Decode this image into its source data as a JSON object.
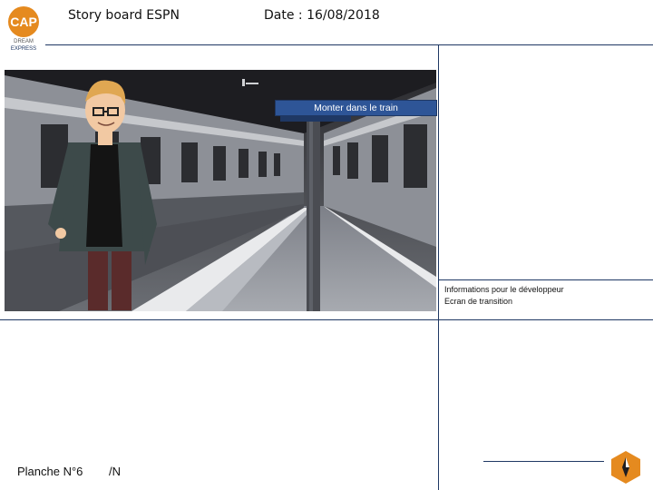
{
  "header": {
    "title": "Story board ESPN",
    "date": "Date : 16/08/2018",
    "logo_text": "CAP DREAM EXPRESS"
  },
  "scene": {
    "description_tag": "Monter dans le train"
  },
  "info_panel": {
    "heading": "Informations pour le développeur",
    "note": "Ecran de transition"
  },
  "footer": {
    "plate_label": "Planche N°6",
    "page_label": "/N"
  },
  "colors": {
    "rule": "#1f3864",
    "tag_bg": "#2e5597",
    "logo_accent": "#e58a1f"
  }
}
